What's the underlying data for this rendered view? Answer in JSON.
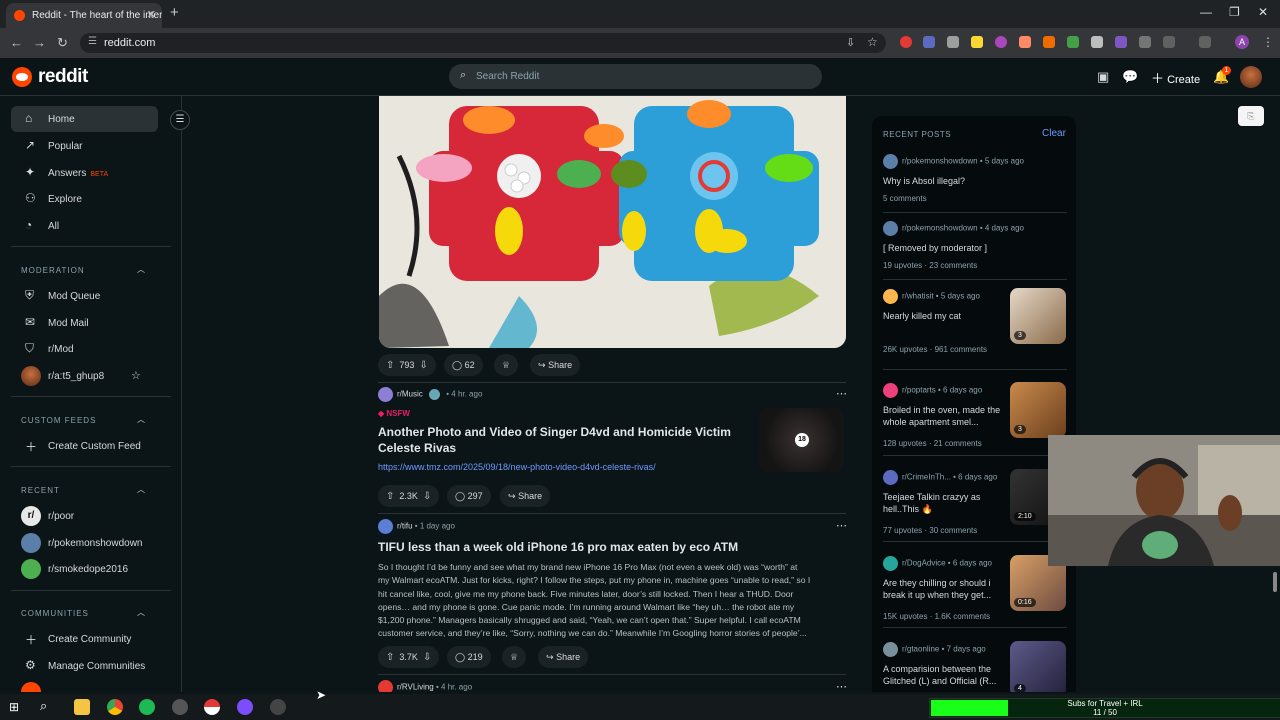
{
  "browser": {
    "tab_title": "Reddit - The heart of the intern",
    "url": "reddit.com",
    "profile_initial": "A"
  },
  "header": {
    "logo_text": "reddit",
    "search_placeholder": "Search Reddit",
    "create_label": "Create",
    "notification_count": "1"
  },
  "sidebar": {
    "nav": [
      {
        "label": "Home",
        "icon": "home-icon"
      },
      {
        "label": "Popular",
        "icon": "popular-icon"
      },
      {
        "label": "Answers",
        "icon": "answers-icon",
        "badge": "BETA"
      },
      {
        "label": "Explore",
        "icon": "explore-icon"
      },
      {
        "label": "All",
        "icon": "all-icon"
      }
    ],
    "moderation_header": "MODERATION",
    "moderation": [
      "Mod Queue",
      "Mod Mail",
      "r/Mod",
      "r/a:t5_ghup8"
    ],
    "custom_feeds_header": "CUSTOM FEEDS",
    "create_custom_feed": "Create Custom Feed",
    "recent_header": "RECENT",
    "recent": [
      "r/poor",
      "r/pokemonshowdown",
      "r/smokedope2016"
    ],
    "communities_header": "COMMUNITIES",
    "create_community": "Create Community",
    "manage_communities": "Manage Communities"
  },
  "feed": {
    "share_label": "Share",
    "post1": {
      "votes": "793",
      "comments": "62"
    },
    "post2": {
      "subreddit": "r/Music",
      "time": "4 hr. ago",
      "nsfw": "NSFW",
      "title_line1": "Another Photo and Video of Singer D4vd and Homicide Victim",
      "title_line2": "Celeste Rivas",
      "link": "https://www.tmz.com/2025/09/18/new-photo-video-d4vd-celeste-rivas/",
      "nsfw_thumb": "18",
      "votes": "2.3K",
      "comments": "297"
    },
    "post3": {
      "subreddit": "r/tifu",
      "time": "1 day ago",
      "title": "TIFU less than a week old iPhone 16 pro max eaten by eco ATM",
      "body": [
        "So I thought I’d be funny and see what my brand new iPhone 16 Pro Max (not even a week old) was “worth” at",
        "my Walmart ecoATM. Just for kicks, right? I follow the steps, put my phone in, machine goes “unable to read,” so I",
        "hit cancel like, cool, give me my phone back. Five minutes later, door’s still locked. Then I hear a THUD. Door",
        "opens… and my phone is gone. Cue panic mode. I’m running around Walmart like “hey uh… the robot ate my",
        "$1,200 phone.” Managers basically shrugged and said, “Yeah, we can’t open that.” Super helpful. I call ecoATM",
        "customer service, and they’re like, “Sorry, nothing we can do.” Meanwhile I’m Googling horror stories of people’..."
      ],
      "votes": "3.7K",
      "comments": "219"
    },
    "post4": {
      "subreddit": "r/RVLiving",
      "time": "4 hr. ago"
    }
  },
  "rail": {
    "header": "RECENT POSTS",
    "clear": "Clear",
    "posts": [
      {
        "sub": "r/pokemonshowdown",
        "time": "5 days ago",
        "title": "Why is Absol illegal?",
        "stats": "5 comments"
      },
      {
        "sub": "r/pokemonshowdown",
        "time": "4 days ago",
        "title": "[ Removed by moderator ]",
        "stats": "19 upvotes · 23 comments"
      },
      {
        "sub": "r/whatisit",
        "time": "5 days ago",
        "title": "Nearly killed my cat",
        "stats": "26K upvotes · 961 comments",
        "badge": "3"
      },
      {
        "sub": "r/poptarts",
        "time": "6 days ago",
        "title": "Broiled in the oven, made the whole apartment smel...",
        "stats": "128 upvotes · 21 comments",
        "badge": "3"
      },
      {
        "sub": "r/CrimeInTh...",
        "time": "6 days ago",
        "title": "Teejaee Talkin crazyy as hell..This 🔥",
        "stats": "77 upvotes · 30 comments",
        "badge": "2:10"
      },
      {
        "sub": "r/DogAdvice",
        "time": "6 days ago",
        "title": "Are they chilling or should i break it up when they get...",
        "stats": "15K upvotes · 1.6K comments",
        "badge": "0:16"
      },
      {
        "sub": "r/gtaonline",
        "time": "7 days ago",
        "title": "A comparision between the Glitched (L) and Official (R...",
        "stats": "",
        "badge": "4"
      }
    ]
  },
  "overlay": {
    "sub_goal_label": "Subs for Travel + IRL",
    "sub_goal_count": "11 / 50",
    "sub_goal_progress": 0.22
  },
  "colors": {
    "brand": "#ff4500",
    "background": "#0b1416",
    "link": "#6e9bff",
    "goal": "#19ff19"
  }
}
